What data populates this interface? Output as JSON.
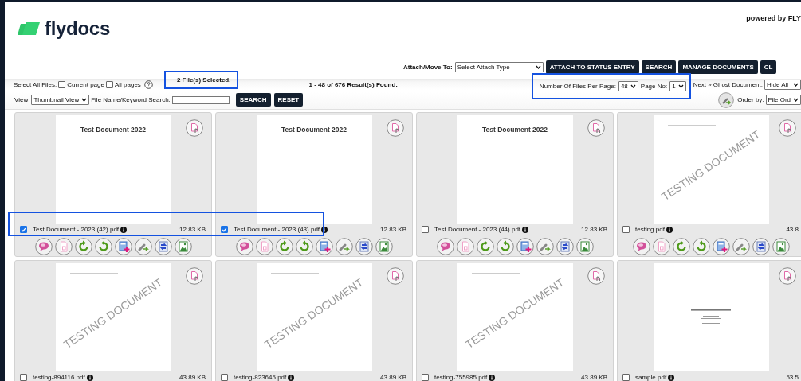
{
  "header": {
    "logo_text": "flydocs",
    "powered_by": "powered by FLY"
  },
  "toolbar": {
    "attach_label": "Attach/Move To:",
    "attach_select": "Select Attach Type",
    "buttons": [
      "ATTACH TO STATUS ENTRY",
      "SEARCH",
      "MANAGE DOCUMENTS",
      "CL"
    ]
  },
  "selection_bar": {
    "select_all_label": "Select All Files:",
    "options": [
      {
        "label": "Current page",
        "checked": false
      },
      {
        "label": "All pages",
        "checked": false
      }
    ],
    "selected_count": "2 File(s) Selected.",
    "results": "1 - 48 of 676 Result(s) Found.",
    "per_page_label": "Number Of Files Per Page:",
    "per_page": "48",
    "page_label": "Page No:",
    "page": "1",
    "next_link": "Next »",
    "ghost_label": "Ghost Document:",
    "ghost_select": "Hide All"
  },
  "search_bar": {
    "view_label": "View:",
    "view_select": "Thumbnail View",
    "search_label": "File Name/Keyword Search:",
    "buttons": [
      "SEARCH",
      "RESET"
    ],
    "order_label": "Order by:",
    "order_select": "File Ord"
  },
  "files": [
    {
      "name": "Test Document - 2023 (42).pdf",
      "size": "12.83 KB",
      "checked": true,
      "preview": {
        "kind": "title",
        "text": "Test Document 2022"
      }
    },
    {
      "name": "Test Document - 2023 (43).pdf",
      "size": "12.83 KB",
      "checked": true,
      "preview": {
        "kind": "title",
        "text": "Test Document 2022"
      }
    },
    {
      "name": "Test Document - 2023 (44).pdf",
      "size": "12.83 KB",
      "checked": false,
      "preview": {
        "kind": "title",
        "text": "Test Document 2022"
      }
    },
    {
      "name": "testing.pdf",
      "size": "43.8",
      "checked": false,
      "preview": {
        "kind": "watermark",
        "text": "TESTING DOCUMENT"
      }
    },
    {
      "name": "testing-894116.pdf",
      "size": "43.89 KB",
      "checked": false,
      "preview": {
        "kind": "watermark",
        "text": "TESTING DOCUMENT"
      }
    },
    {
      "name": "testing-823645.pdf",
      "size": "43.89 KB",
      "checked": false,
      "preview": {
        "kind": "watermark",
        "text": "TESTING DOCUMENT"
      }
    },
    {
      "name": "testing-755985.pdf",
      "size": "43.89 KB",
      "checked": false,
      "preview": {
        "kind": "watermark",
        "text": "TESTING DOCUMENT"
      }
    },
    {
      "name": "sample.pdf",
      "size": "53.5",
      "checked": false,
      "preview": {
        "kind": "sample"
      }
    }
  ],
  "highlights": {
    "selected_count": true,
    "selected_files": true,
    "pagination": true
  }
}
